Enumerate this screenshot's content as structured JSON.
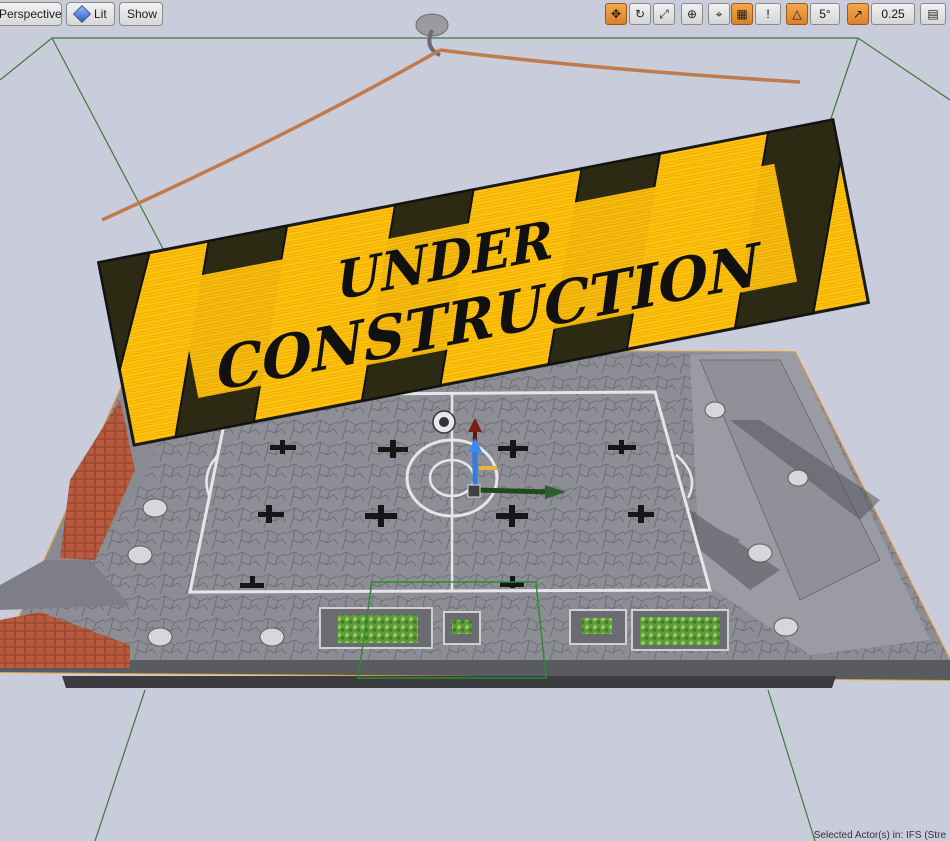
{
  "toolbar": {
    "view_mode_label": "Perspective",
    "lighting_label": "Lit",
    "show_label": "Show",
    "rotation_snap_value": "5°",
    "scale_snap_value": "0.25"
  },
  "sign": {
    "line1": "UNDER",
    "line2": "CONSTRUCTION"
  },
  "status": {
    "text": "Selected Actor(s) in: IFS (Stre"
  },
  "icons": {
    "view_mode": "chevron-down-icon",
    "lighting": "lit-sphere-icon",
    "translate": "move-icon",
    "rotate": "rotate-icon",
    "scale": "scale-icon",
    "world_local": "globe-icon",
    "surface_snap": "surface-snap-icon",
    "grid_snap": "grid-icon",
    "rotation_snap": "angle-icon",
    "scale_snap": "scale-arrow-icon",
    "camera_speed": "camera-speed-icon"
  },
  "colors": {
    "viewport_bg": "#c9ccda",
    "active_tool": "#e8923a",
    "sign_yellow": "#ffc20f",
    "rope": "#c07a4c"
  }
}
